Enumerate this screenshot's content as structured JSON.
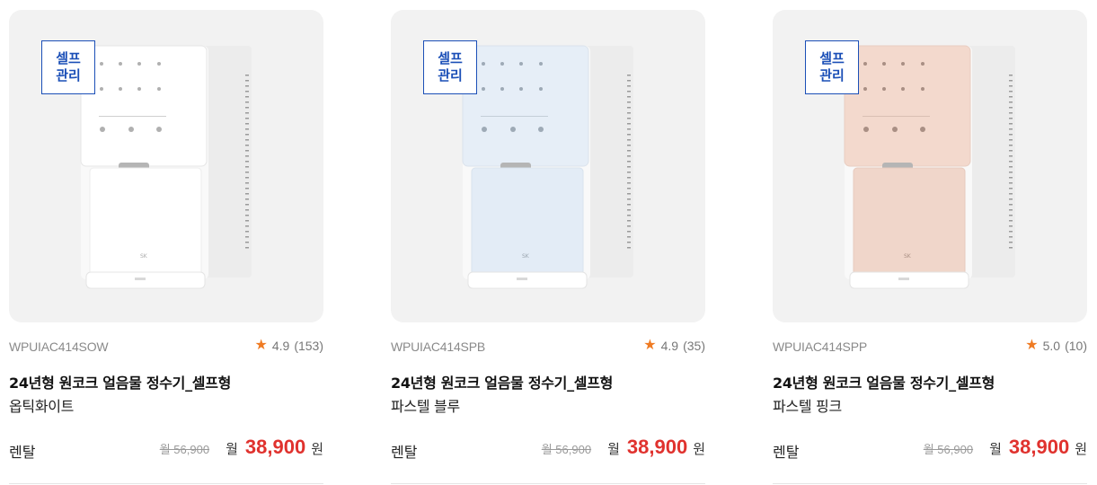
{
  "products": [
    {
      "badge_line1": "셀프",
      "badge_line2": "관리",
      "model": "WPUIAC414SOW",
      "rating": "4.9",
      "reviews": "(153)",
      "name": "24년형 원코크 얼음물 정수기_셀프형",
      "color": "옵틱화이트",
      "type": "렌탈",
      "original_price": "월 56,900",
      "price_prefix": "월",
      "price": "38,900",
      "price_unit": "원",
      "panel_color": "#ffffff",
      "lower_color": "#ffffff"
    },
    {
      "badge_line1": "셀프",
      "badge_line2": "관리",
      "model": "WPUIAC414SPB",
      "rating": "4.9",
      "reviews": "(35)",
      "name": "24년형 원코크 얼음물 정수기_셀프형",
      "color": "파스텔 블루",
      "type": "렌탈",
      "original_price": "월 56,900",
      "price_prefix": "월",
      "price": "38,900",
      "price_unit": "원",
      "panel_color": "#e6eef7",
      "lower_color": "#e3ecf6"
    },
    {
      "badge_line1": "셀프",
      "badge_line2": "관리",
      "model": "WPUIAC414SPP",
      "rating": "5.0",
      "reviews": "(10)",
      "name": "24년형 원코크 얼음물 정수기_셀프형",
      "color": "파스텔 핑크",
      "type": "렌탈",
      "original_price": "월 56,900",
      "price_prefix": "월",
      "price": "38,900",
      "price_unit": "원",
      "panel_color": "#f3d9cd",
      "lower_color": "#f0d6ca"
    }
  ],
  "colors": {
    "badge": "#1b4fb7",
    "price": "#e0322e",
    "star": "#ef7b23"
  },
  "icons": {
    "rating": "star-icon"
  }
}
